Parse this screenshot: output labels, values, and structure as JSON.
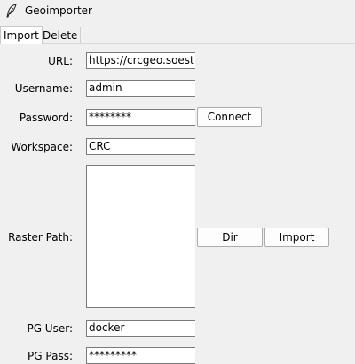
{
  "window": {
    "title": "Geoimporter",
    "minimize_glyph": "—"
  },
  "tabs": [
    {
      "label": "Import",
      "active": true
    },
    {
      "label": "Delete",
      "active": false
    }
  ],
  "form": {
    "url_label": "URL:",
    "url_value": "https://crcgeo.soest.hawaii.edu/geoserver",
    "username_label": "Username:",
    "username_value": "admin",
    "password_label": "Password:",
    "password_value": "********",
    "connect_label": "Connect",
    "workspace_label": "Workspace:",
    "workspace_value": "CRC",
    "raster_label": "Raster Path:",
    "dir_label": "Dir",
    "import_label": "Import",
    "pguser_label": "PG User:",
    "pguser_value": "docker",
    "pgpass_label": "PG Pass:",
    "pgpass_value": "*********"
  }
}
